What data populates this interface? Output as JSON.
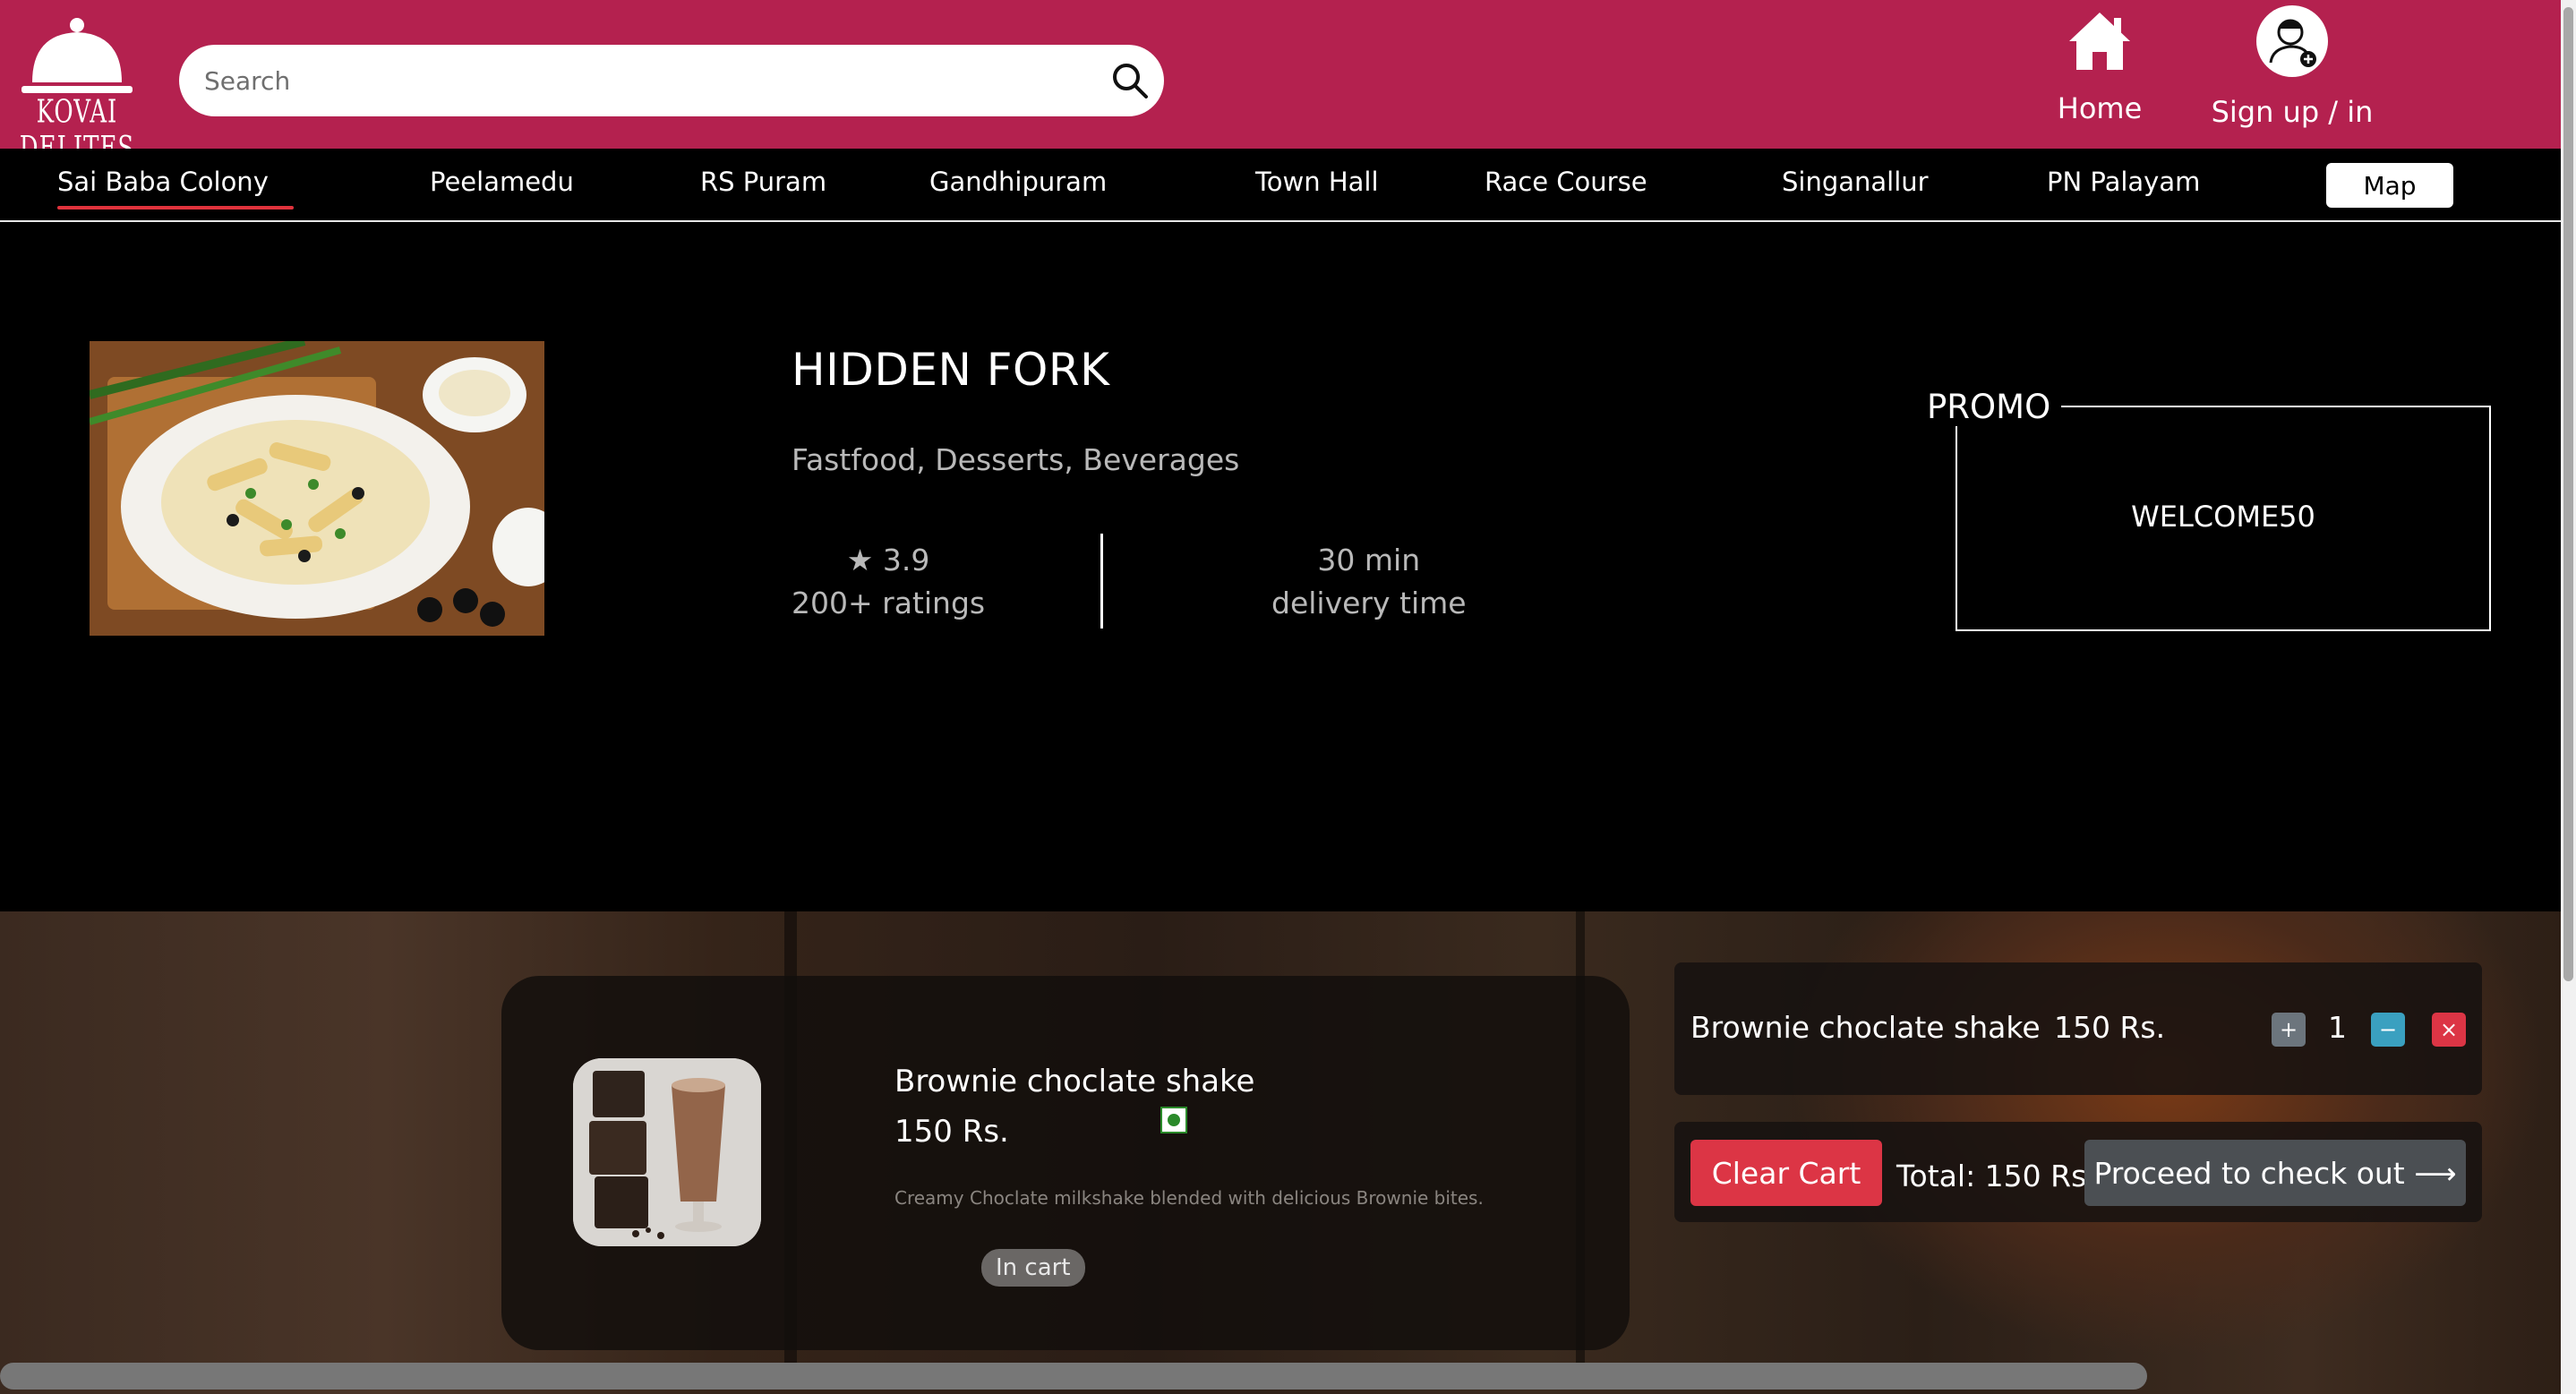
{
  "header": {
    "logo_text": "KOVAI DELITES",
    "search_placeholder": "Search",
    "nav": [
      {
        "label": "Home",
        "icon": "home-icon"
      },
      {
        "label": "Sign up / in",
        "icon": "user-add-icon"
      }
    ],
    "colors": {
      "brand": "#b4214f"
    }
  },
  "locations": {
    "items": [
      "Sai Baba Colony",
      "Peelamedu",
      "RS Puram",
      "Gandhipuram",
      "Town Hall",
      "Race Course",
      "Singanallur",
      "PN Palayam"
    ],
    "active": "Sai Baba Colony",
    "map_label": "Map"
  },
  "restaurant": {
    "name": "HIDDEN FORK",
    "cuisines": "Fastfood, Desserts, Beverages",
    "rating": "★ 3.9",
    "ratings_count": "200+ ratings",
    "delivery_time": "30 min",
    "delivery_label": "delivery time",
    "promo_title": "PROMO",
    "promo_code": "WELCOME50"
  },
  "menu_item": {
    "name": "Brownie choclate shake",
    "price": "150 Rs.",
    "description": "Creamy Choclate milkshake blended with delicious Brownie bites.",
    "status": "In cart",
    "veg": true
  },
  "cart": {
    "item_name": "Brownie choclate shake",
    "item_price": "150 Rs.",
    "quantity": "1",
    "plus": "+",
    "minus": "−",
    "remove": "×",
    "clear_label": "Clear Cart",
    "total": "Total: 150 Rs.",
    "checkout_label": "Proceed to check out ⟶",
    "colors": {
      "clear": "#dc3545",
      "minus": "#3aa0c0",
      "remove": "#dc3545",
      "plus": "#6c757d"
    }
  }
}
